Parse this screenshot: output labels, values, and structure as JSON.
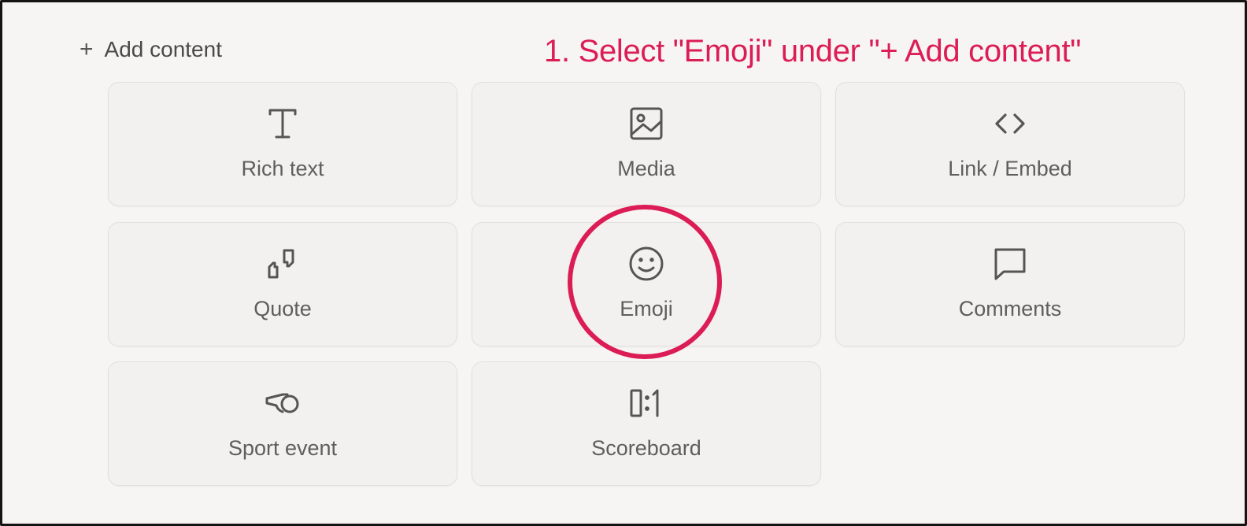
{
  "header": {
    "add_content_icon": "plus-icon",
    "add_content_label": "Add content",
    "annotation": "1. Select \"Emoji\" under \"+ Add content\""
  },
  "tiles": [
    {
      "label": "Rich text",
      "icon": "text-icon"
    },
    {
      "label": "Media",
      "icon": "image-icon"
    },
    {
      "label": "Link / Embed",
      "icon": "code-icon"
    },
    {
      "label": "Quote",
      "icon": "quote-icon"
    },
    {
      "label": "Emoji",
      "icon": "smiley-icon"
    },
    {
      "label": "Comments",
      "icon": "comment-icon"
    },
    {
      "label": "Sport event",
      "icon": "whistle-icon"
    },
    {
      "label": "Scoreboard",
      "icon": "scoreboard-icon"
    }
  ],
  "colors": {
    "annotation": "#dc1c55",
    "background": "#f6f5f3",
    "tile": "#f2f1ef",
    "text": "#5e5e5e"
  }
}
